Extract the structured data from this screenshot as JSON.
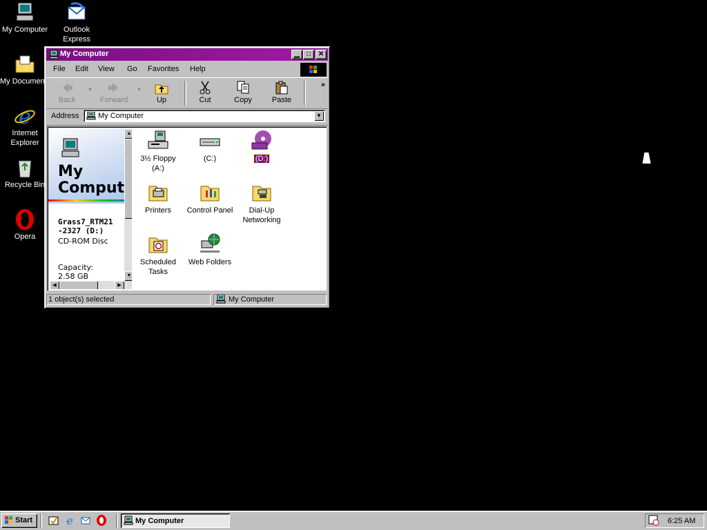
{
  "desktop": {
    "icons": [
      {
        "label": "My Computer",
        "icon": "my-computer-icon"
      },
      {
        "label": "Outlook",
        "label2": "Express",
        "icon": "outlook-express-icon"
      },
      {
        "label": "My Documents",
        "icon": "my-documents-icon"
      },
      {
        "label": "Internet",
        "label2": "Explorer",
        "icon": "internet-explorer-icon"
      },
      {
        "label": "Recycle Bin",
        "icon": "recycle-bin-icon"
      },
      {
        "label": "Opera",
        "icon": "opera-icon"
      }
    ]
  },
  "window": {
    "title": "My Computer",
    "accent": "#7a0f7f",
    "menu": [
      "File",
      "Edit",
      "View",
      "Go",
      "Favorites",
      "Help"
    ],
    "toolbar": {
      "back": "Back",
      "forward": "Forward",
      "up": "Up",
      "cut": "Cut",
      "copy": "Copy",
      "paste": "Paste",
      "more": "»"
    },
    "address": {
      "label": "Address",
      "value": "My Computer"
    },
    "left_pane": {
      "title": "My Computer",
      "name_line1": "Grass7_RTM21",
      "name_line2": "-2327 (D:)",
      "type": "CD-ROM Disc",
      "capacity_label": "Capacity:",
      "capacity_value": "2.58 GB"
    },
    "items": [
      {
        "label": "3½ Floppy",
        "label2": "(A:)",
        "icon": "floppy-drive-icon"
      },
      {
        "label": "(C:)",
        "icon": "hard-drive-icon"
      },
      {
        "label": "(D:)",
        "icon": "cd-rom-icon",
        "selected": true
      },
      {
        "label": "Printers",
        "icon": "printers-folder-icon"
      },
      {
        "label": "Control Panel",
        "icon": "control-panel-icon"
      },
      {
        "label": "Dial-Up",
        "label2": "Networking",
        "icon": "dialup-networking-icon"
      },
      {
        "label": "Scheduled",
        "label2": "Tasks",
        "icon": "scheduled-tasks-icon"
      },
      {
        "label": "Web Folders",
        "icon": "web-folders-icon"
      }
    ],
    "status": {
      "left": "1 object(s) selected",
      "right": "My Computer"
    }
  },
  "taskbar": {
    "start": "Start",
    "task": "My Computer",
    "clock": "6:25 AM"
  }
}
